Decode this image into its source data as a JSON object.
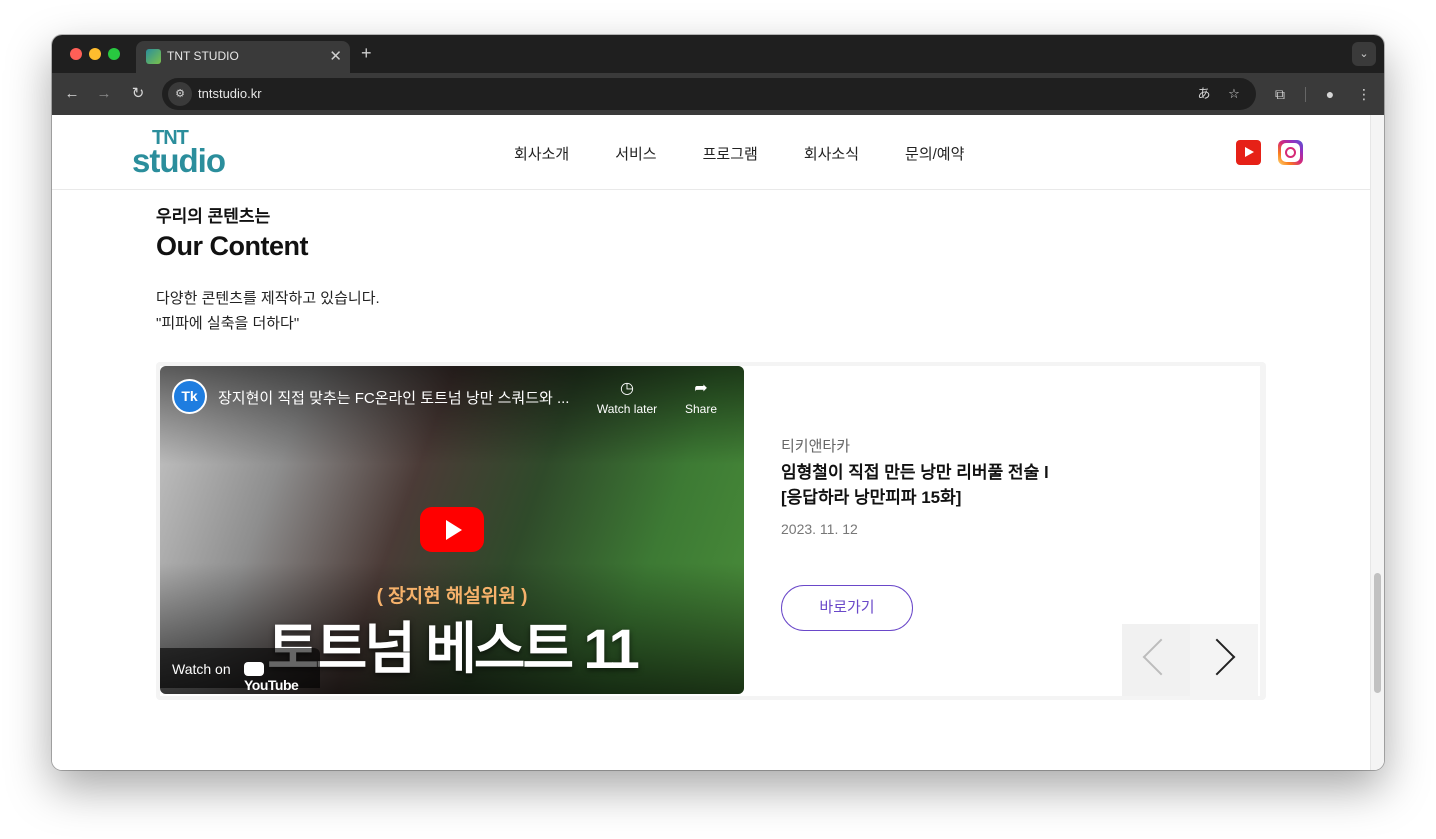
{
  "browser": {
    "tab_title": "TNT STUDIO",
    "url": "tntstudio.kr"
  },
  "site": {
    "logo_top": "TNT",
    "logo_bottom": "studio",
    "nav": [
      "회사소개",
      "서비스",
      "프로그램",
      "회사소식",
      "문의/예약"
    ]
  },
  "section": {
    "kicker": "우리의 콘텐츠는",
    "title": "Our Content",
    "desc_line1": "다양한 콘텐츠를 제작하고 있습니다.",
    "desc_line2": "\"피파에 실축을 더하다\""
  },
  "video": {
    "channel_avatar": "Tk",
    "title": "장지현이 직접 맞추는 FC온라인 토트넘 낭만 스쿼드와 ...",
    "watch_later": "Watch later",
    "share": "Share",
    "thumb_sub": "( 장지현 해설위원 )",
    "thumb_main": "토트넘 베스트 11",
    "watch_on": "Watch on",
    "youtube": "YouTube"
  },
  "post": {
    "channel": "티키앤타카",
    "title_line1": "임형철이 직접 만든 낭만 리버풀 전술 l",
    "title_line2": "[응답하라 낭만피파 15화]",
    "date": "2023. 11. 12",
    "button": "바로가기"
  }
}
